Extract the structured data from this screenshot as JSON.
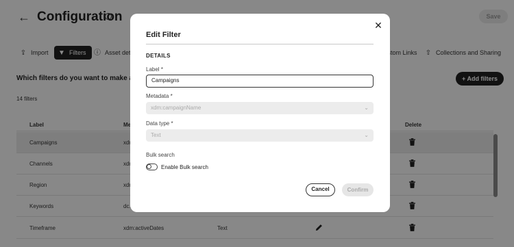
{
  "header": {
    "title": "Configuration",
    "save_label": "Save"
  },
  "tabs": [
    {
      "label": "Import",
      "icon": "import-icon"
    },
    {
      "label": "Filters",
      "icon": "filter-icon",
      "active": true
    },
    {
      "label": "Asset detail",
      "icon": "info-icon"
    },
    {
      "label": "Custom Links",
      "icon": "link-icon"
    },
    {
      "label": "Collections and Sharing",
      "icon": "share-icon"
    }
  ],
  "main": {
    "question": "Which filters do you want to make available",
    "add_filters_label": "Add filters",
    "count": "14 filters"
  },
  "table": {
    "columns": {
      "label": "Label",
      "metadata": "Metadata",
      "delete": "Delete"
    },
    "rows": [
      {
        "label": "Campaigns",
        "metadata": "xdm",
        "type": ""
      },
      {
        "label": "Channels",
        "metadata": "xdm",
        "type": ""
      },
      {
        "label": "Region",
        "metadata": "xdm",
        "type": ""
      },
      {
        "label": "Keywords",
        "metadata": "dc.",
        "type": ""
      },
      {
        "label": "Timeframe",
        "metadata": "xdm:activeDates",
        "type": "Text"
      }
    ]
  },
  "modal": {
    "title": "Edit Filter",
    "section": "DETAILS",
    "label_field": {
      "label": "Label",
      "required": "*",
      "value": "Campaigns"
    },
    "metadata_field": {
      "label": "Metadata",
      "required": "*",
      "value": "xdm:campaignName"
    },
    "datatype_field": {
      "label": "Data type",
      "required": "*",
      "value": "Text"
    },
    "bulk_search": {
      "heading": "Bulk search",
      "toggle_label": "Enable Bulk search",
      "enabled": false
    },
    "cancel_label": "Cancel",
    "confirm_label": "Confirm"
  }
}
